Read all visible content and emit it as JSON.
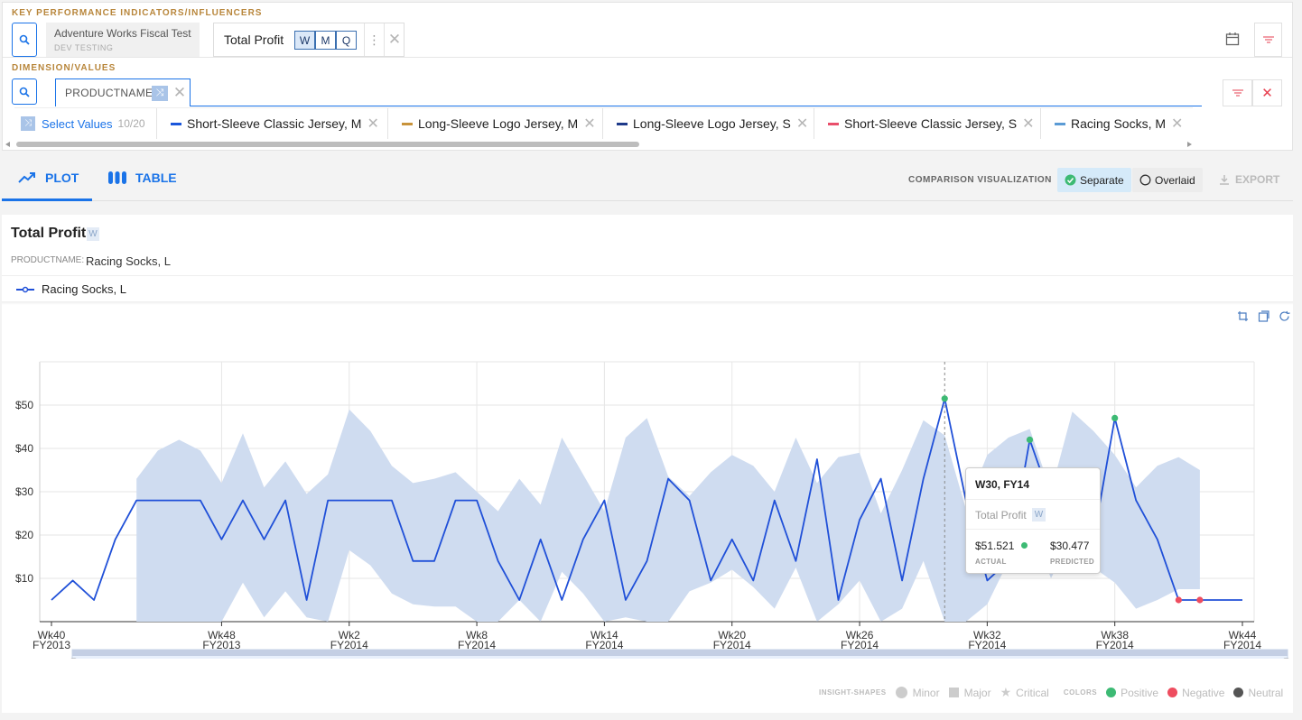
{
  "kpi": {
    "section_label": "KEY PERFORMANCE INDICATORS/INFLUENCERS",
    "dataset_name": "Adventure Works Fiscal Test",
    "dataset_sub": "DEV TESTING",
    "kpi_name": "Total Profit",
    "periods": [
      "W",
      "M",
      "Q"
    ],
    "active_period": "W"
  },
  "dimension": {
    "section_label": "DIMENSION/VALUES",
    "dimension_name": "PRODUCTNAME",
    "select_label": "Select Values",
    "select_count": "10/20",
    "values": [
      {
        "label": "Short-Sleeve Classic Jersey, M",
        "color": "#1a56db"
      },
      {
        "label": "Long-Sleeve Logo Jersey, M",
        "color": "#c8933a"
      },
      {
        "label": "Long-Sleeve Logo Jersey, S",
        "color": "#1e3a8a"
      },
      {
        "label": "Short-Sleeve Classic Jersey, S",
        "color": "#e94f6b"
      },
      {
        "label": "Racing Socks, M",
        "color": "#5b9bd5"
      }
    ]
  },
  "tabs": {
    "plot": "PLOT",
    "table": "TABLE",
    "comparison_label": "COMPARISON VISUALIZATION",
    "separate": "Separate",
    "overlaid": "Overlaid",
    "export": "EXPORT"
  },
  "chart_header": {
    "title": "Total Profit",
    "period_badge": "W",
    "filter_key": "PRODUCTNAME:",
    "filter_value": "Racing Socks, L",
    "legend_label": "Racing Socks, L"
  },
  "tooltip": {
    "title": "W30, FY14",
    "metric": "Total Profit",
    "badge": "W",
    "actual": "$51.521",
    "actual_label": "ACTUAL",
    "predicted": "$30.477",
    "predicted_label": "PREDICTED"
  },
  "bottom_legend": {
    "shapes_label": "INSIGHT-SHAPES",
    "minor": "Minor",
    "major": "Major",
    "critical": "Critical",
    "colors_label": "COLORS",
    "positive": "Positive",
    "negative": "Negative",
    "neutral": "Neutral"
  },
  "colors": {
    "accent": "#1a73e8",
    "line": "#2050d8",
    "band": "#cfdcf0",
    "positive": "#3dba74",
    "negative": "#ee4d5f",
    "neutral": "#555555"
  },
  "chart_data": {
    "type": "line",
    "title": "Total Profit",
    "ylim": [
      0,
      60
    ],
    "yticks": [
      10,
      20,
      30,
      40,
      50
    ],
    "ytick_labels": [
      "$10",
      "$20",
      "$30",
      "$40",
      "$50"
    ],
    "xtick_labels": [
      [
        "Wk40",
        "FY2013"
      ],
      [
        "Wk48",
        "FY2013"
      ],
      [
        "Wk2",
        "FY2014"
      ],
      [
        "Wk8",
        "FY2014"
      ],
      [
        "Wk14",
        "FY2014"
      ],
      [
        "Wk20",
        "FY2014"
      ],
      [
        "Wk26",
        "FY2014"
      ],
      [
        "Wk32",
        "FY2014"
      ],
      [
        "Wk38",
        "FY2014"
      ],
      [
        "Wk44",
        "FY2014"
      ]
    ],
    "series": [
      {
        "name": "Racing Socks, L",
        "values": [
          5,
          9.5,
          5,
          19,
          28,
          28,
          28,
          28,
          19,
          28,
          19,
          28,
          5,
          28,
          28,
          28,
          28,
          14,
          14,
          28,
          28,
          14,
          5,
          19,
          5,
          19,
          28,
          5,
          14,
          33,
          28,
          9.5,
          19,
          9.5,
          28,
          14,
          37.5,
          5,
          23.5,
          33,
          9.5,
          33,
          51.5,
          28,
          9.5,
          14,
          42,
          28,
          23.5,
          19,
          47,
          28,
          19,
          5,
          5,
          5,
          5
        ]
      }
    ],
    "band": {
      "start_index": 4,
      "upper": [
        33,
        39.5,
        42,
        39.5,
        32,
        43.5,
        31,
        37,
        29.5,
        34,
        49,
        44,
        36,
        32,
        33,
        34.5,
        30,
        25.5,
        33,
        27,
        42.5,
        34,
        25.5,
        42.5,
        47,
        33.5,
        29,
        34.5,
        38.5,
        36,
        30,
        42.5,
        32,
        38,
        39,
        25,
        35,
        46.5,
        43,
        26,
        38.5,
        42.5,
        44.5,
        30,
        48.5,
        44,
        38.5,
        31,
        36,
        38,
        35
      ],
      "lower": [
        0,
        0,
        0,
        0,
        0,
        9,
        1,
        7,
        1,
        0,
        16.5,
        13,
        6.5,
        4,
        3.5,
        3.5,
        0,
        0,
        5,
        0,
        11.5,
        6.5,
        0,
        1,
        0,
        0,
        7,
        9,
        12,
        8,
        3,
        12.5,
        0,
        4,
        9.5,
        0,
        3,
        14,
        0,
        0,
        4,
        14,
        23,
        10,
        20,
        12.5,
        9,
        3,
        5,
        7.5,
        7.5
      ]
    },
    "tooltip_index": 42,
    "insights": [
      {
        "index": 42,
        "type": "positive"
      },
      {
        "index": 46,
        "type": "positive"
      },
      {
        "index": 50,
        "type": "positive"
      },
      {
        "index": 49,
        "type": "negative"
      },
      {
        "index": 53,
        "type": "negative"
      },
      {
        "index": 54,
        "type": "negative"
      }
    ]
  }
}
